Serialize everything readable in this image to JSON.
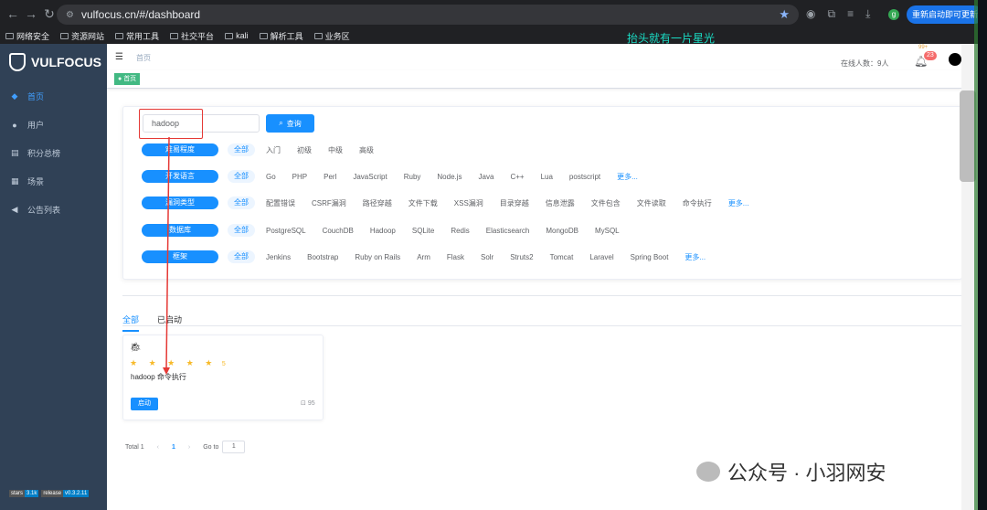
{
  "browser": {
    "url": "vulfocus.cn/#/dashboard",
    "update_button": "重新启动即可更新",
    "bookmarks": [
      "网络安全",
      "资源网站",
      "常用工具",
      "社交平台",
      "kali",
      "解析工具",
      "业务区"
    ]
  },
  "overlay_text": "抬头就有一片星光",
  "sidebar": {
    "brand": "VULFOCUS",
    "items": [
      {
        "label": "首页",
        "icon": "dashboard-icon"
      },
      {
        "label": "用户",
        "icon": "user-icon"
      },
      {
        "label": "积分总榜",
        "icon": "rank-icon"
      },
      {
        "label": "场景",
        "icon": "grid-icon"
      },
      {
        "label": "公告列表",
        "icon": "announce-icon"
      }
    ],
    "badges": [
      {
        "left": "stars",
        "right": "3.1k"
      },
      {
        "left": "release",
        "right": "v0.3.2.11"
      }
    ]
  },
  "navbar": {
    "breadcrumb": "首页",
    "online_users": "在线人数：9人",
    "notification_count": "23",
    "notification_top": "99+"
  },
  "tagsbar": {
    "active_tag": "首页"
  },
  "search": {
    "value": "hadoop",
    "button": "查询"
  },
  "filters": [
    {
      "category": "难易程度",
      "all": "全部",
      "options": [
        "入门",
        "初级",
        "中级",
        "高级"
      ]
    },
    {
      "category": "开发语言",
      "all": "全部",
      "options": [
        "Go",
        "PHP",
        "Perl",
        "JavaScript",
        "Ruby",
        "Node.js",
        "Java",
        "C++",
        "Lua",
        "postscript"
      ],
      "more": "更多..."
    },
    {
      "category": "漏洞类型",
      "all": "全部",
      "options": [
        "配置错误",
        "CSRF漏洞",
        "路径穿越",
        "文件下载",
        "XSS漏洞",
        "目录穿越",
        "信息泄露",
        "文件包含",
        "文件读取",
        "命令执行"
      ],
      "more": "更多..."
    },
    {
      "category": "数据库",
      "all": "全部",
      "options": [
        "PostgreSQL",
        "CouchDB",
        "Hadoop",
        "SQLite",
        "Redis",
        "Elasticsearch",
        "MongoDB",
        "MySQL"
      ]
    },
    {
      "category": "框架",
      "all": "全部",
      "options": [
        "Jenkins",
        "Bootstrap",
        "Ruby on Rails",
        "Arm",
        "Flask",
        "Solr",
        "Struts2",
        "Tomcat",
        "Laravel",
        "Spring Boot"
      ],
      "more": "更多..."
    }
  ],
  "tabs": [
    "全部",
    "已启动"
  ],
  "vuln": {
    "name": "hadoop 命令执行",
    "rating": 5,
    "stars": "★ ★ ★ ★ ★",
    "score": "5",
    "start_button": "启动",
    "downloads": "95"
  },
  "pagination": {
    "total": "Total 1",
    "current": "1",
    "goto_label": "Go to",
    "goto_value": "1"
  },
  "watermark": "公众号 · 小羽网安"
}
